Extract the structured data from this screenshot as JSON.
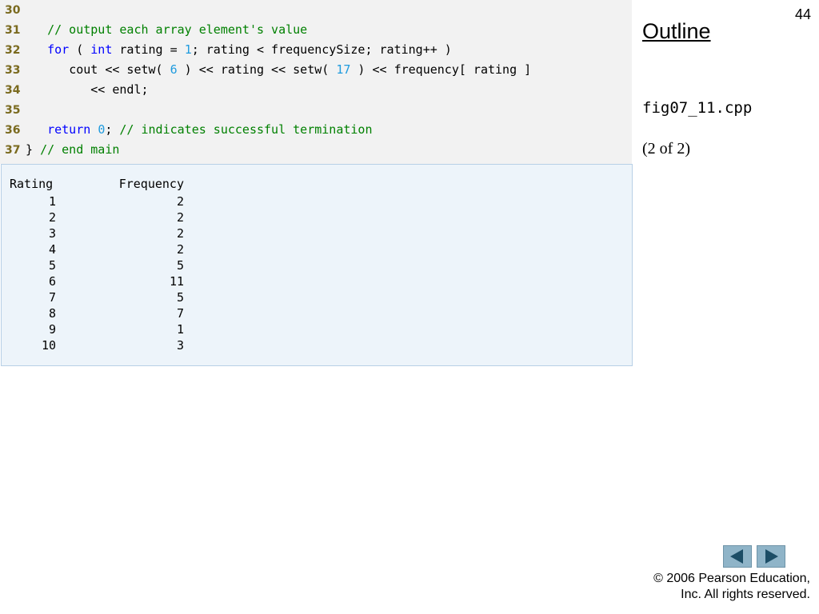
{
  "slide": {
    "page_number": "44",
    "outline_label": "Outline",
    "file_name": "fig07_11.cpp",
    "part_label": "(2 of 2)",
    "copyright_line1": "© 2006 Pearson Education,",
    "copyright_line2": "Inc.  All rights reserved."
  },
  "code": {
    "l30": {
      "no": "30"
    },
    "l31": {
      "no": "31",
      "indent": "   ",
      "comment": "// output each array element's value"
    },
    "l32": {
      "no": "32",
      "indent": "   ",
      "kw1": "for",
      "t1": " ( ",
      "kw2": "int",
      "t2": " rating = ",
      "n1": "1",
      "t3": "; rating < frequencySize; rating++ )"
    },
    "l33": {
      "no": "33",
      "indent": "      ",
      "t1": "cout << setw( ",
      "n1": "6",
      "t2": " ) << rating << setw( ",
      "n2": "17",
      "t3": " ) << frequency[ rating ]"
    },
    "l34": {
      "no": "34",
      "indent": "         ",
      "t1": "<< endl;"
    },
    "l35": {
      "no": "35"
    },
    "l36": {
      "no": "36",
      "indent": "   ",
      "kw1": "return",
      "t1": " ",
      "n1": "0",
      "t2": "; ",
      "comment": "// indicates successful termination"
    },
    "l37": {
      "no": "37",
      "indent": "",
      "t1": "} ",
      "comment": "// end main"
    }
  },
  "output": {
    "header_rating": "Rating",
    "header_frequency": "Frequency",
    "rows": [
      {
        "rating": "1",
        "frequency": "2"
      },
      {
        "rating": "2",
        "frequency": "2"
      },
      {
        "rating": "3",
        "frequency": "2"
      },
      {
        "rating": "4",
        "frequency": "2"
      },
      {
        "rating": "5",
        "frequency": "5"
      },
      {
        "rating": "6",
        "frequency": "11"
      },
      {
        "rating": "7",
        "frequency": "5"
      },
      {
        "rating": "8",
        "frequency": "7"
      },
      {
        "rating": "9",
        "frequency": "1"
      },
      {
        "rating": "10",
        "frequency": "3"
      }
    ]
  },
  "navigation": {
    "prev_icon": "left-triangle-icon",
    "next_icon": "right-triangle-icon"
  },
  "colors": {
    "line_number": "#7a6a1e",
    "keyword": "#0000ff",
    "number_literal": "#1f9bde",
    "comment": "#008000",
    "code_background": "#f2f2f2",
    "output_background": "#edf4fa",
    "nav_button": "#8fb4c8"
  }
}
